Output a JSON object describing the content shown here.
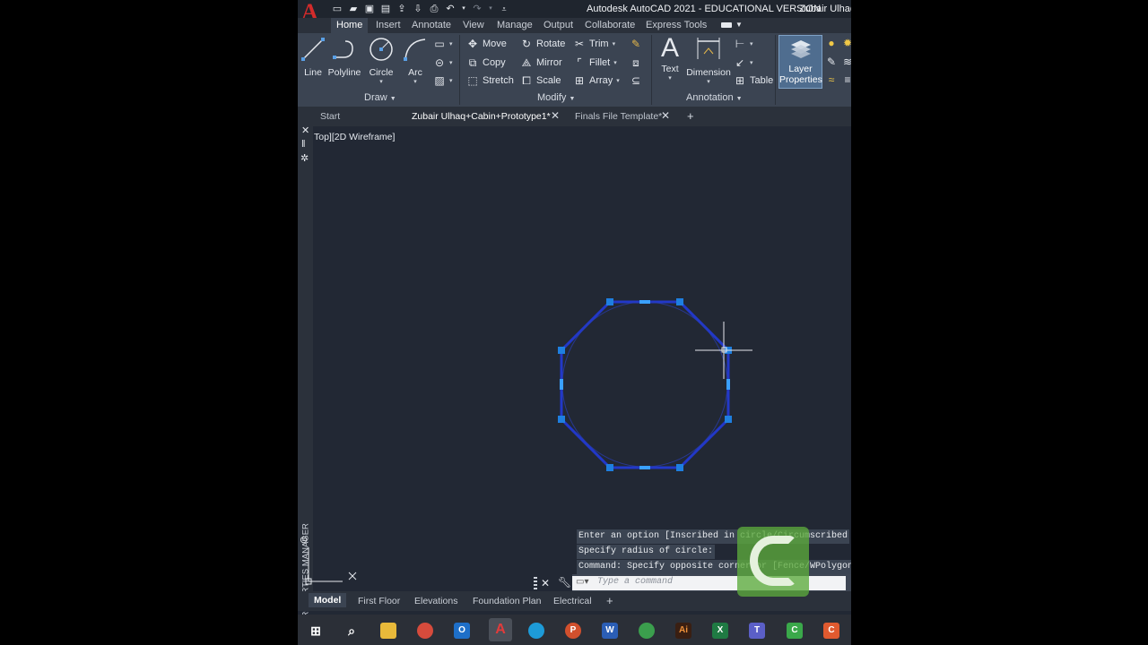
{
  "window": {
    "app_title": "Autodesk AutoCAD 2021 - EDUCATIONAL VERSION",
    "user": "Zubair Ulhaq",
    "logo_letter": "A"
  },
  "ribbon_tabs": [
    "Home",
    "Insert",
    "Annotate",
    "View",
    "Manage",
    "Output",
    "Collaborate",
    "Express Tools"
  ],
  "ribbon": {
    "draw": {
      "title": "Draw",
      "tools": [
        "Line",
        "Polyline",
        "Circle",
        "Arc"
      ]
    },
    "modify": {
      "title": "Modify",
      "tools": [
        "Move",
        "Rotate",
        "Trim",
        "Copy",
        "Mirror",
        "Fillet",
        "Stretch",
        "Scale",
        "Array"
      ]
    },
    "annotation": {
      "title": "Annotation",
      "text": "Text",
      "dimension": "Dimension",
      "table": "Table"
    },
    "layers": {
      "layer_properties_line1": "Layer",
      "layer_properties_line2": "Properties"
    }
  },
  "doc_tabs": [
    {
      "label": "Start"
    },
    {
      "label": "Zubair Ulhaq+Cabin+Prototype1*"
    },
    {
      "label": "Finals File Template*"
    }
  ],
  "viewport_label": "Top][2D Wireframe]",
  "side_panel_title": "LAYER PROPERTIES MANAGER",
  "command_history": [
    "Enter an option [Inscribed in circle/Circumscribed",
    "Specify radius of circle:",
    "Command: Specify opposite corner or [Fence/WPolygon"
  ],
  "command_placeholder": "Type a command",
  "layout_tabs": [
    "Model",
    "First Floor",
    "Elevations",
    "Foundation Plan",
    "Electrical"
  ],
  "colors": {
    "polygon": "#2238c8",
    "grip": "#1e7fe0",
    "canvas": "#222834",
    "ribbon": "#3b4452"
  },
  "taskbar_icons": [
    "windows-icon",
    "search-icon",
    "file-explorer-icon",
    "chrome-icon",
    "outlook-icon",
    "autocad-icon",
    "edge-icon",
    "powerpoint-icon",
    "word-icon",
    "chrome-icon",
    "illustrator-icon",
    "excel-icon",
    "teams-icon",
    "camtasia-icon",
    "camtasia-recorder-icon"
  ]
}
